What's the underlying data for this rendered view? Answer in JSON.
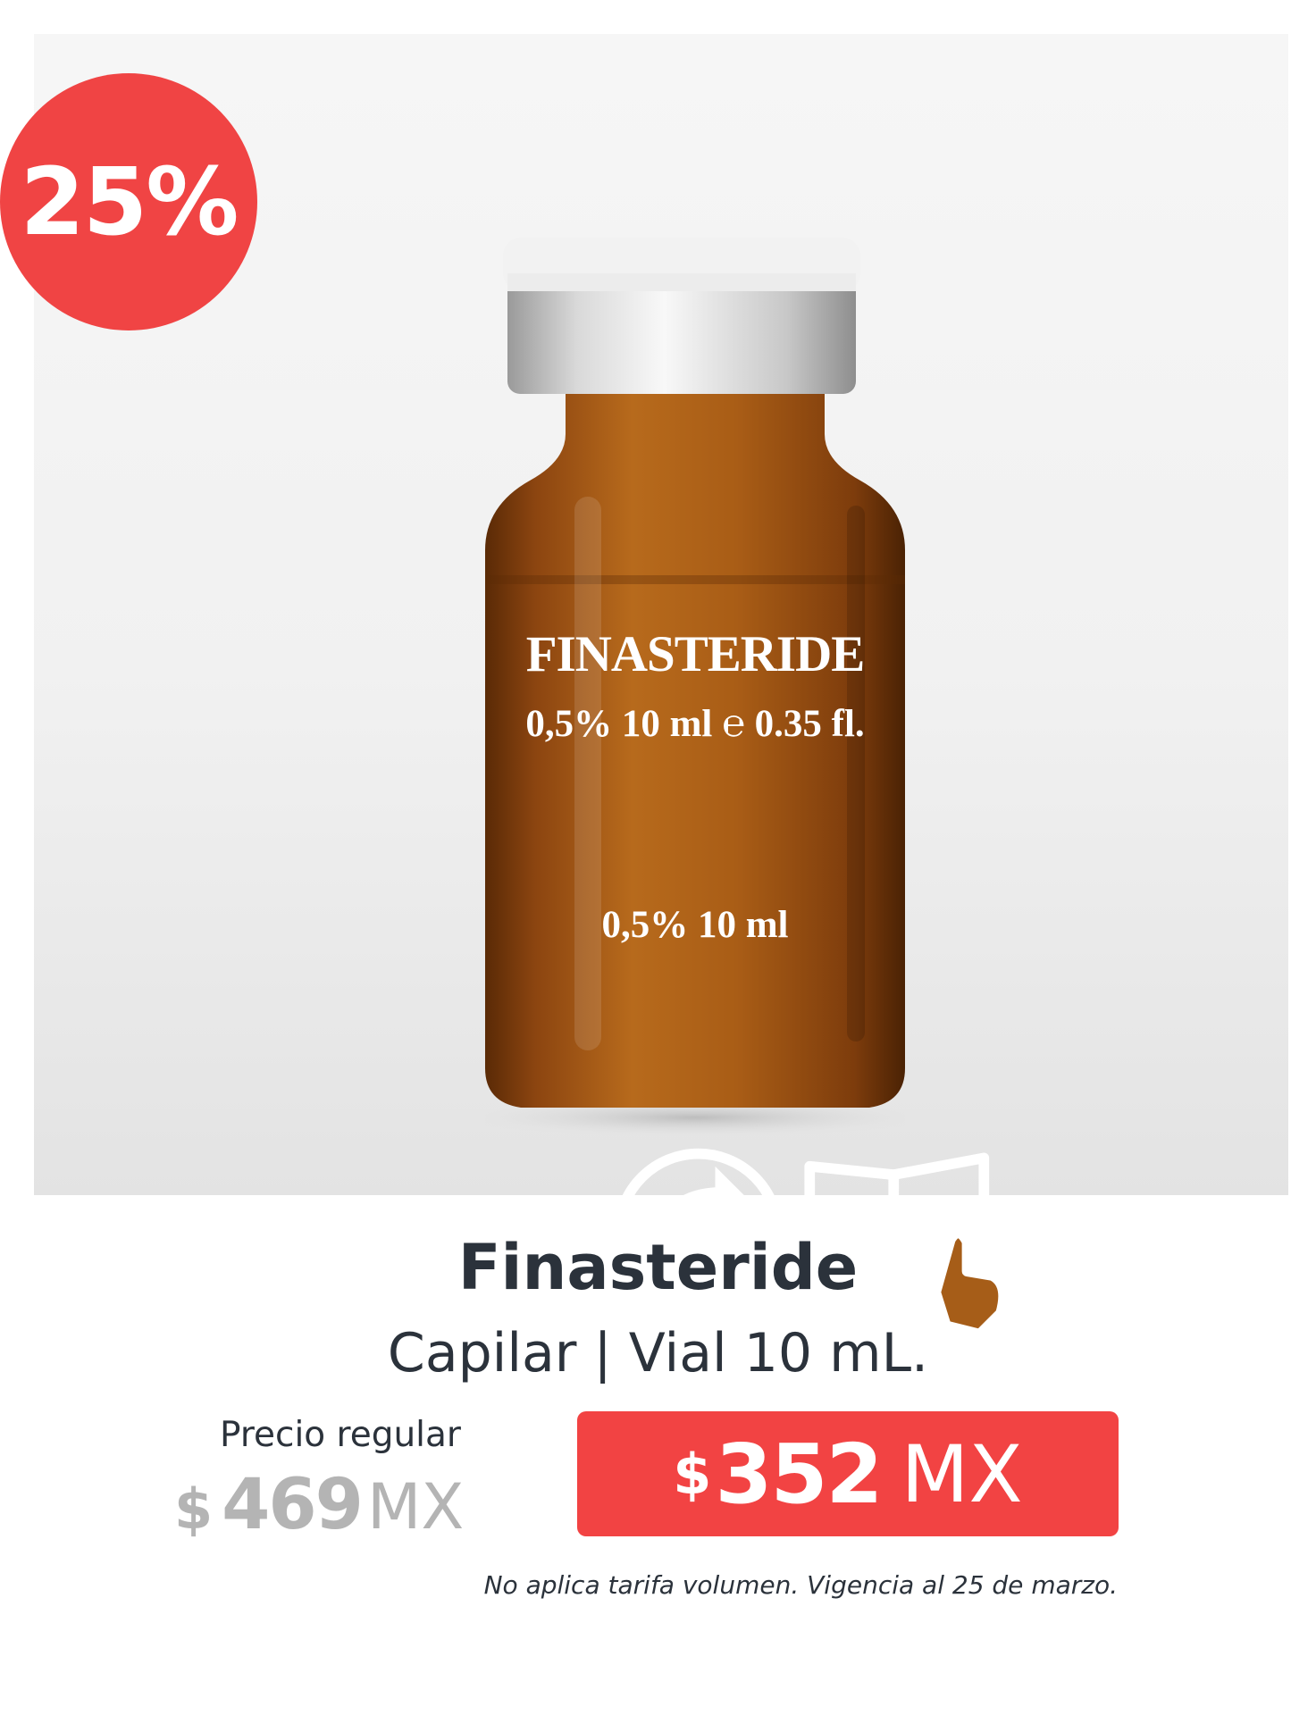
{
  "discount_badge": "25%",
  "vial": {
    "label_title": "FINASTERIDE",
    "label_spec": "0,5% 10 ml  ℮ 0.35 fl.",
    "label_spec_bottom": "0,5% 10 ml",
    "icons": [
      "recycle-icon",
      "read-instructions-icon"
    ],
    "colors": {
      "glass": "#a0520f",
      "cap": "#e9e9e9"
    }
  },
  "product": {
    "name": "Finasteride",
    "subtitle": "Capilar | Vial 10 mL."
  },
  "pricing": {
    "regular_label": "Precio regular",
    "regular_currency": "$",
    "regular_amount": "469",
    "regular_unit": "MX",
    "sale_currency": "$",
    "sale_amount": "352",
    "sale_unit": "MX"
  },
  "disclaimer": "No aplica tarifa volumen. Vigencia al 25 de marzo.",
  "colors": {
    "accent": "#f24343",
    "text": "#2b323b",
    "muted": "#b4b4b4"
  }
}
